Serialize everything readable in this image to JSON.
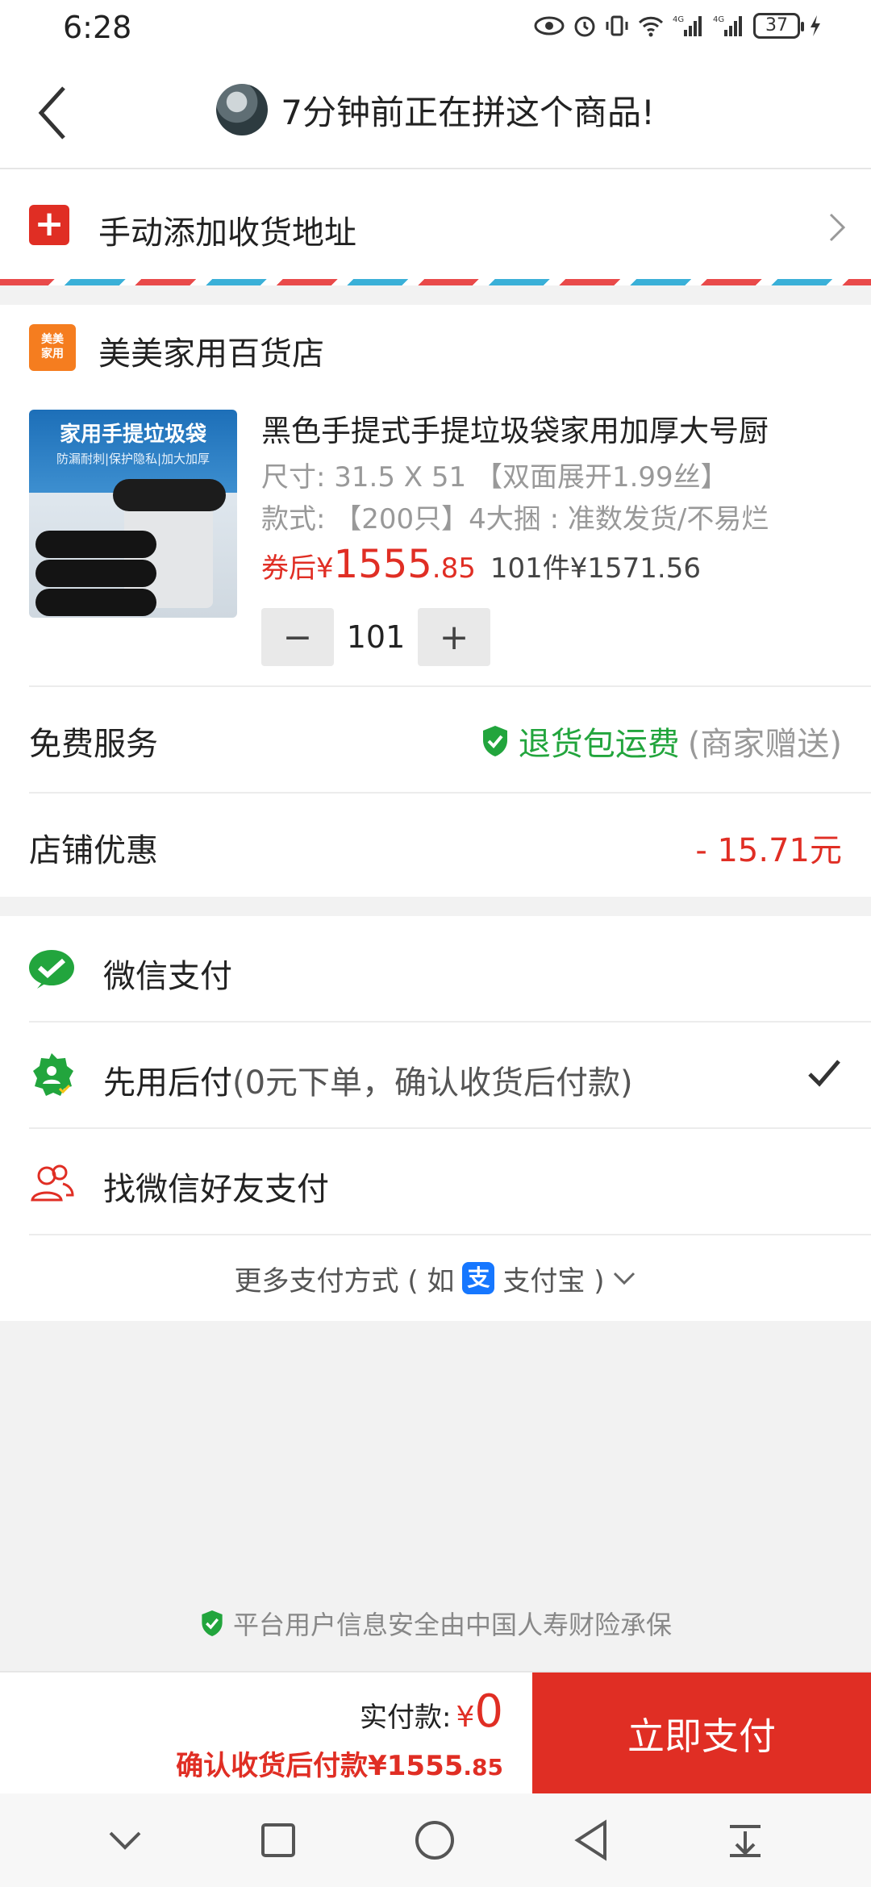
{
  "status_bar": {
    "time": "6:28",
    "battery": "37"
  },
  "header": {
    "title": "7分钟前正在拼这个商品!"
  },
  "address": {
    "label": "手动添加收货地址"
  },
  "store": {
    "logo_text": "美美\n家用",
    "name": "美美家用百货店"
  },
  "product": {
    "image_title": "家用手提垃圾袋",
    "image_subtitle": "防漏耐刺|保护隐私|加大加厚",
    "title": "黑色手提式手提垃圾袋家用加厚大号厨",
    "spec_size": "尺寸: 31.5 X 51 【双面展开1.99丝】",
    "spec_style": "款式: 【200只】4大捆 : 准数发货/不易烂",
    "price_prefix": "券后",
    "price_yen": "¥",
    "price_int": "1555",
    "price_dec": ".85",
    "qty_total": "101件¥1571.56"
  },
  "stepper": {
    "minus": "−",
    "value": "101",
    "plus": "+"
  },
  "services": {
    "label": "免费服务",
    "value": "退货包运费",
    "note": "(商家赠送)"
  },
  "discount": {
    "label": "店铺优惠",
    "value": "- 15.71元"
  },
  "payments": [
    {
      "label": "微信支付"
    },
    {
      "label": "先用后付",
      "note": "(0元下单，确认收货后付款)"
    },
    {
      "label": "找微信好友支付"
    }
  ],
  "more_pay": {
    "prefix": "更多支付方式 ( 如",
    "alipay_glyph": "支",
    "name": "支付宝 )"
  },
  "security": {
    "text": "平台用户信息安全由中国人寿财险承保"
  },
  "bottom": {
    "actual_label": "实付款:",
    "actual_yen": "¥",
    "actual_amount": "0",
    "after_pay_main": "确认收货后付款¥1555",
    "after_pay_dec": ".85",
    "pay_button": "立即支付"
  },
  "colors": {
    "accent": "#e02e24",
    "green": "#22a53d",
    "alipay": "#1677ff"
  }
}
